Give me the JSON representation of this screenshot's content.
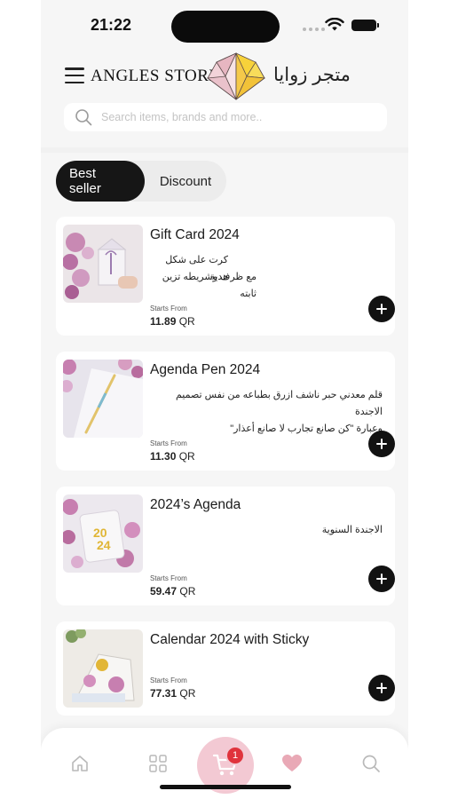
{
  "status_bar": {
    "time": "21:22"
  },
  "header": {
    "brand_en": "ANGLES STORE",
    "brand_ar": "متجر زوايا",
    "search_placeholder": "Search items, brands and more.."
  },
  "tabs": [
    {
      "label": "Best seller",
      "active": true
    },
    {
      "label": "Discount",
      "active": false
    }
  ],
  "products": [
    {
      "name": "Gift Card 2024",
      "desc_lines": [
        "كرت على شكل هدية",
        "مع ظرف وشريطه تزين ثابته"
      ],
      "starts_label": "Starts From",
      "price": "11.89",
      "currency": "QR"
    },
    {
      "name": "Agenda Pen 2024",
      "desc_lines": [
        "قلم معدني حبر ناشف ازرق بطباعه من نفس تصميم الاجندة",
        "وعبارة \"كن صانع تجارب لا صانع أعذار\""
      ],
      "starts_label": "Starts From",
      "price": "11.30",
      "currency": "QR"
    },
    {
      "name": "2024’s Agenda",
      "desc_lines": [
        "الاجندة السنوية"
      ],
      "starts_label": "Starts From",
      "price": "59.47",
      "currency": "QR"
    },
    {
      "name": "Calendar 2024 with Sticky",
      "desc_lines": [],
      "starts_label": "Starts From",
      "price": "77.31",
      "currency": "QR"
    }
  ],
  "bottom_nav": {
    "items": [
      "home-icon",
      "grid-icon",
      "cart-icon",
      "heart-icon",
      "search-icon"
    ],
    "cart_badge": "1"
  },
  "colors": {
    "accent_dark": "#161616",
    "cart_pink": "#f3c9d3",
    "badge_red": "#e0333c",
    "heart_pink": "#e9a9b6"
  }
}
